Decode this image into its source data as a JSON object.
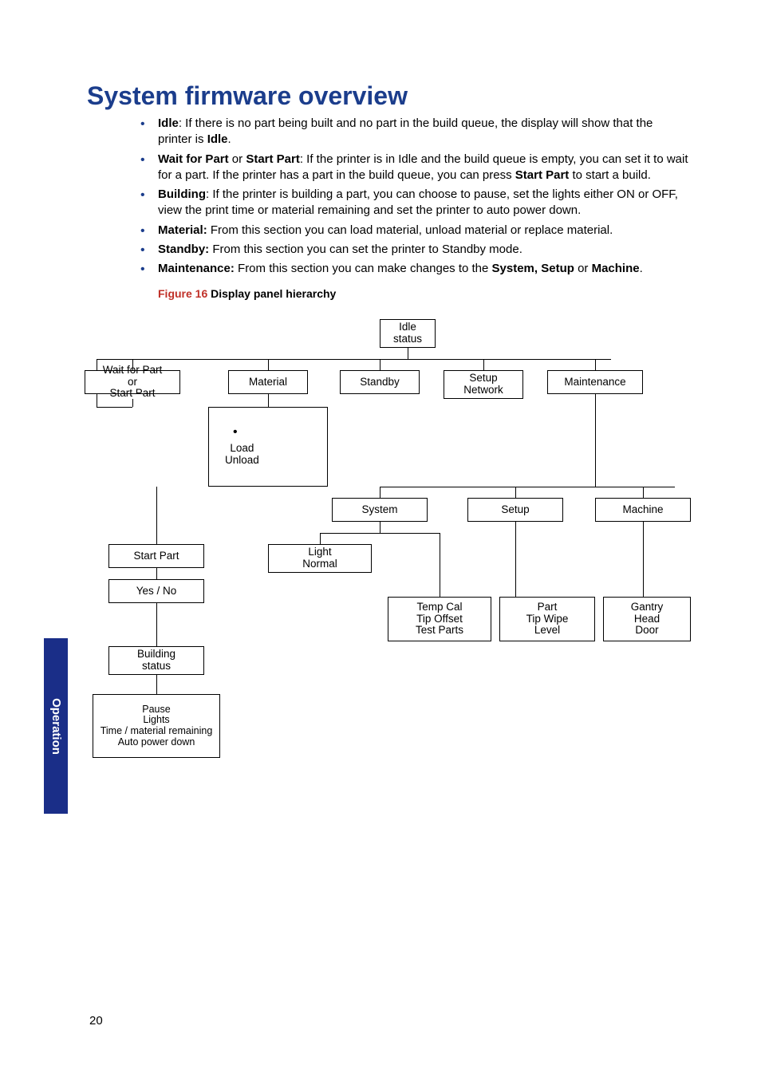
{
  "heading": "System firmware overview",
  "bullets": {
    "b1_strong": "Idle",
    "b1_rest": ": If there is no part being built and no part in the build queue, the display will show that the printer is ",
    "b1_em": "Idle",
    "b1_period": ".",
    "b2_strong": "Wait for Part",
    "b2_or": " or ",
    "b2_strong2": "Start Part",
    "b2_rest_a": ": If the printer is in Idle and the build queue is empty, you can set it to wait for a part. If the printer has a part in the build queue, you can press ",
    "b2_strong3": "Start Part",
    "b2_rest_b": " to start a build.",
    "b3_strong": "Building",
    "b3_rest": ": If the printer is building a part, you can choose to pause, set the lights either ON or OFF, view the print time or material remaining and set the printer to auto power down.",
    "b4_strong": "Material:",
    "b4_rest": " From this section you can load material, unload material or replace material.",
    "b5_strong": "Standby:",
    "b5_rest": " From this section you can set the printer to Standby mode.",
    "b6_strong": "Maintenance:",
    "b6_rest_a": " From this section you can make changes to the ",
    "b6_strong2": "System, Setup",
    "b6_or": " or ",
    "b6_strong3": "Machine",
    "b6_period": "."
  },
  "figure": {
    "label": "Figure 16",
    "title": " Display panel hierarchy"
  },
  "chart_data": {
    "type": "diagram",
    "nodes": {
      "idle": "Idle\nstatus",
      "wait": "Wait for Part\nor\nStart Part",
      "material": "Material",
      "standby": "Standby",
      "setup": "Setup\nNetwork",
      "maintenance": "Maintenance",
      "load_unload": "Load\nUnload",
      "system": "System",
      "setup2": "Setup",
      "machine": "Machine",
      "startpart": "Start Part",
      "yes_no": "Yes / No",
      "light": "Light\nNormal",
      "tempcal": "Temp Cal\nTip Offset\nTest Parts",
      "testlef": "Part\nTip Wipe\nLevel",
      "gantry": "Gantry\nHead\nDoor",
      "building": "Building\nstatus",
      "pause": "Pause\nLights\nTime / material remaining\nAuto power down"
    },
    "edges": [
      [
        "idle",
        "wait"
      ],
      [
        "idle",
        "material"
      ],
      [
        "idle",
        "standby"
      ],
      [
        "idle",
        "setup"
      ],
      [
        "idle",
        "maintenance"
      ],
      [
        "material",
        "load_unload"
      ],
      [
        "maintenance",
        "system"
      ],
      [
        "maintenance",
        "setup2"
      ],
      [
        "maintenance",
        "machine"
      ],
      [
        "wait",
        "startpart"
      ],
      [
        "startpart",
        "yes_no"
      ],
      [
        "system",
        "light"
      ],
      [
        "system",
        "tempcal"
      ],
      [
        "setup2",
        "testlef"
      ],
      [
        "machine",
        "gantry"
      ],
      [
        "building",
        "pause"
      ]
    ]
  },
  "sidetab": "Operation",
  "pagenum": "20"
}
